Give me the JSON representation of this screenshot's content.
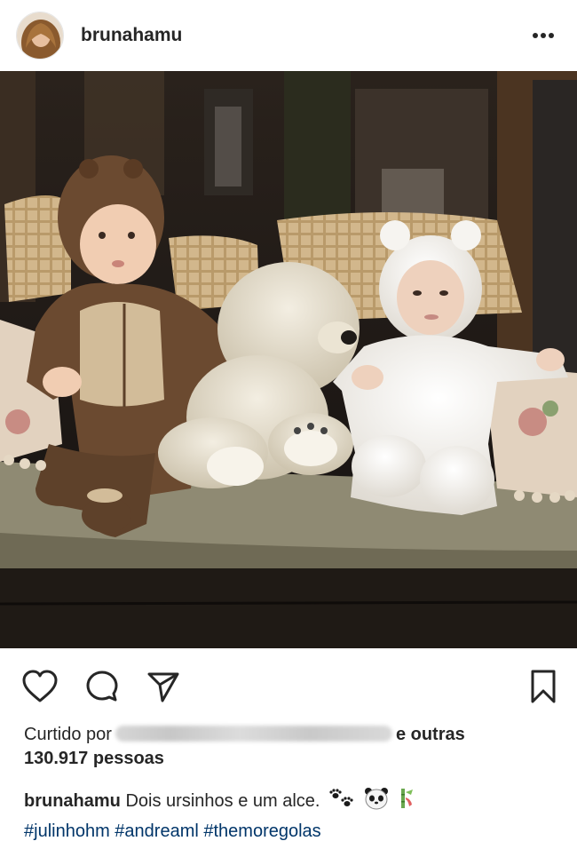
{
  "post": {
    "username": "brunahamu",
    "liked_by_prefix": "Curtido por",
    "liked_by_suffix": "e outras",
    "likes_count": "130.917 pessoas",
    "caption_user": "brunahamu",
    "caption_text": "Dois ursinhos e um alce.",
    "hashtags": [
      "#julinhohm",
      "#andreaml",
      "#themoregolas"
    ],
    "caption_emojis": [
      "paw-prints-icon",
      "panda-icon",
      "bamboo-icon"
    ]
  },
  "icons": {
    "like": "heart-icon",
    "comment": "comment-icon",
    "share": "send-icon",
    "save": "bookmark-icon",
    "more": "more-options-icon"
  }
}
